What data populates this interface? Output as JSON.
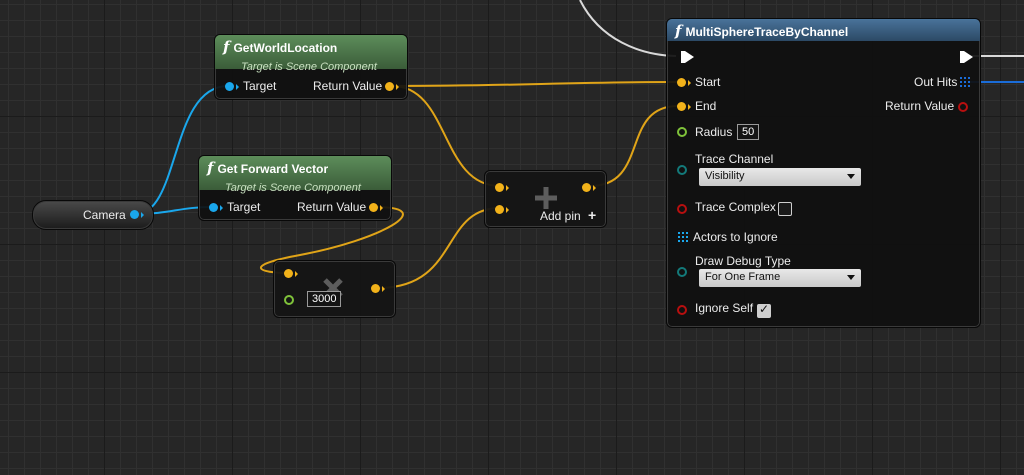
{
  "nodes": {
    "camera": {
      "label": "Camera"
    },
    "get_world_location": {
      "icon": "function-icon",
      "title": "GetWorldLocation",
      "subtitle": "Target is Scene Component",
      "target_label": "Target",
      "return_label": "Return Value"
    },
    "get_forward_vector": {
      "icon": "function-icon",
      "title": "Get Forward Vector",
      "subtitle": "Target is Scene Component",
      "target_label": "Target",
      "return_label": "Return Value"
    },
    "multiply": {
      "icon": "multiply-icon",
      "value": "3000"
    },
    "add": {
      "icon": "plus-icon",
      "add_pin_label": "Add pin"
    },
    "multi_sphere_trace": {
      "icon": "function-icon",
      "title": "MultiSphereTraceByChannel",
      "start_label": "Start",
      "end_label": "End",
      "radius_label": "Radius",
      "radius_value": "50",
      "trace_channel_label": "Trace Channel",
      "trace_channel_value": "Visibility",
      "trace_complex_label": "Trace Complex",
      "trace_complex_checked": false,
      "actors_to_ignore_label": "Actors to Ignore",
      "draw_debug_type_label": "Draw Debug Type",
      "draw_debug_type_value": "For One Frame",
      "ignore_self_label": "Ignore Self",
      "ignore_self_checked": true,
      "out_hits_label": "Out Hits",
      "return_label": "Return Value"
    }
  },
  "colors": {
    "vector_pin": "#f2b21a",
    "object_pin": "#1aa7ec",
    "bool_pin": "#b80f0f",
    "float_pin": "#7fc23a",
    "enum_pin": "#137a7a",
    "exec_pin": "#ffffff",
    "pure_header": "#4f7a4c",
    "call_header": "#3d6387"
  }
}
